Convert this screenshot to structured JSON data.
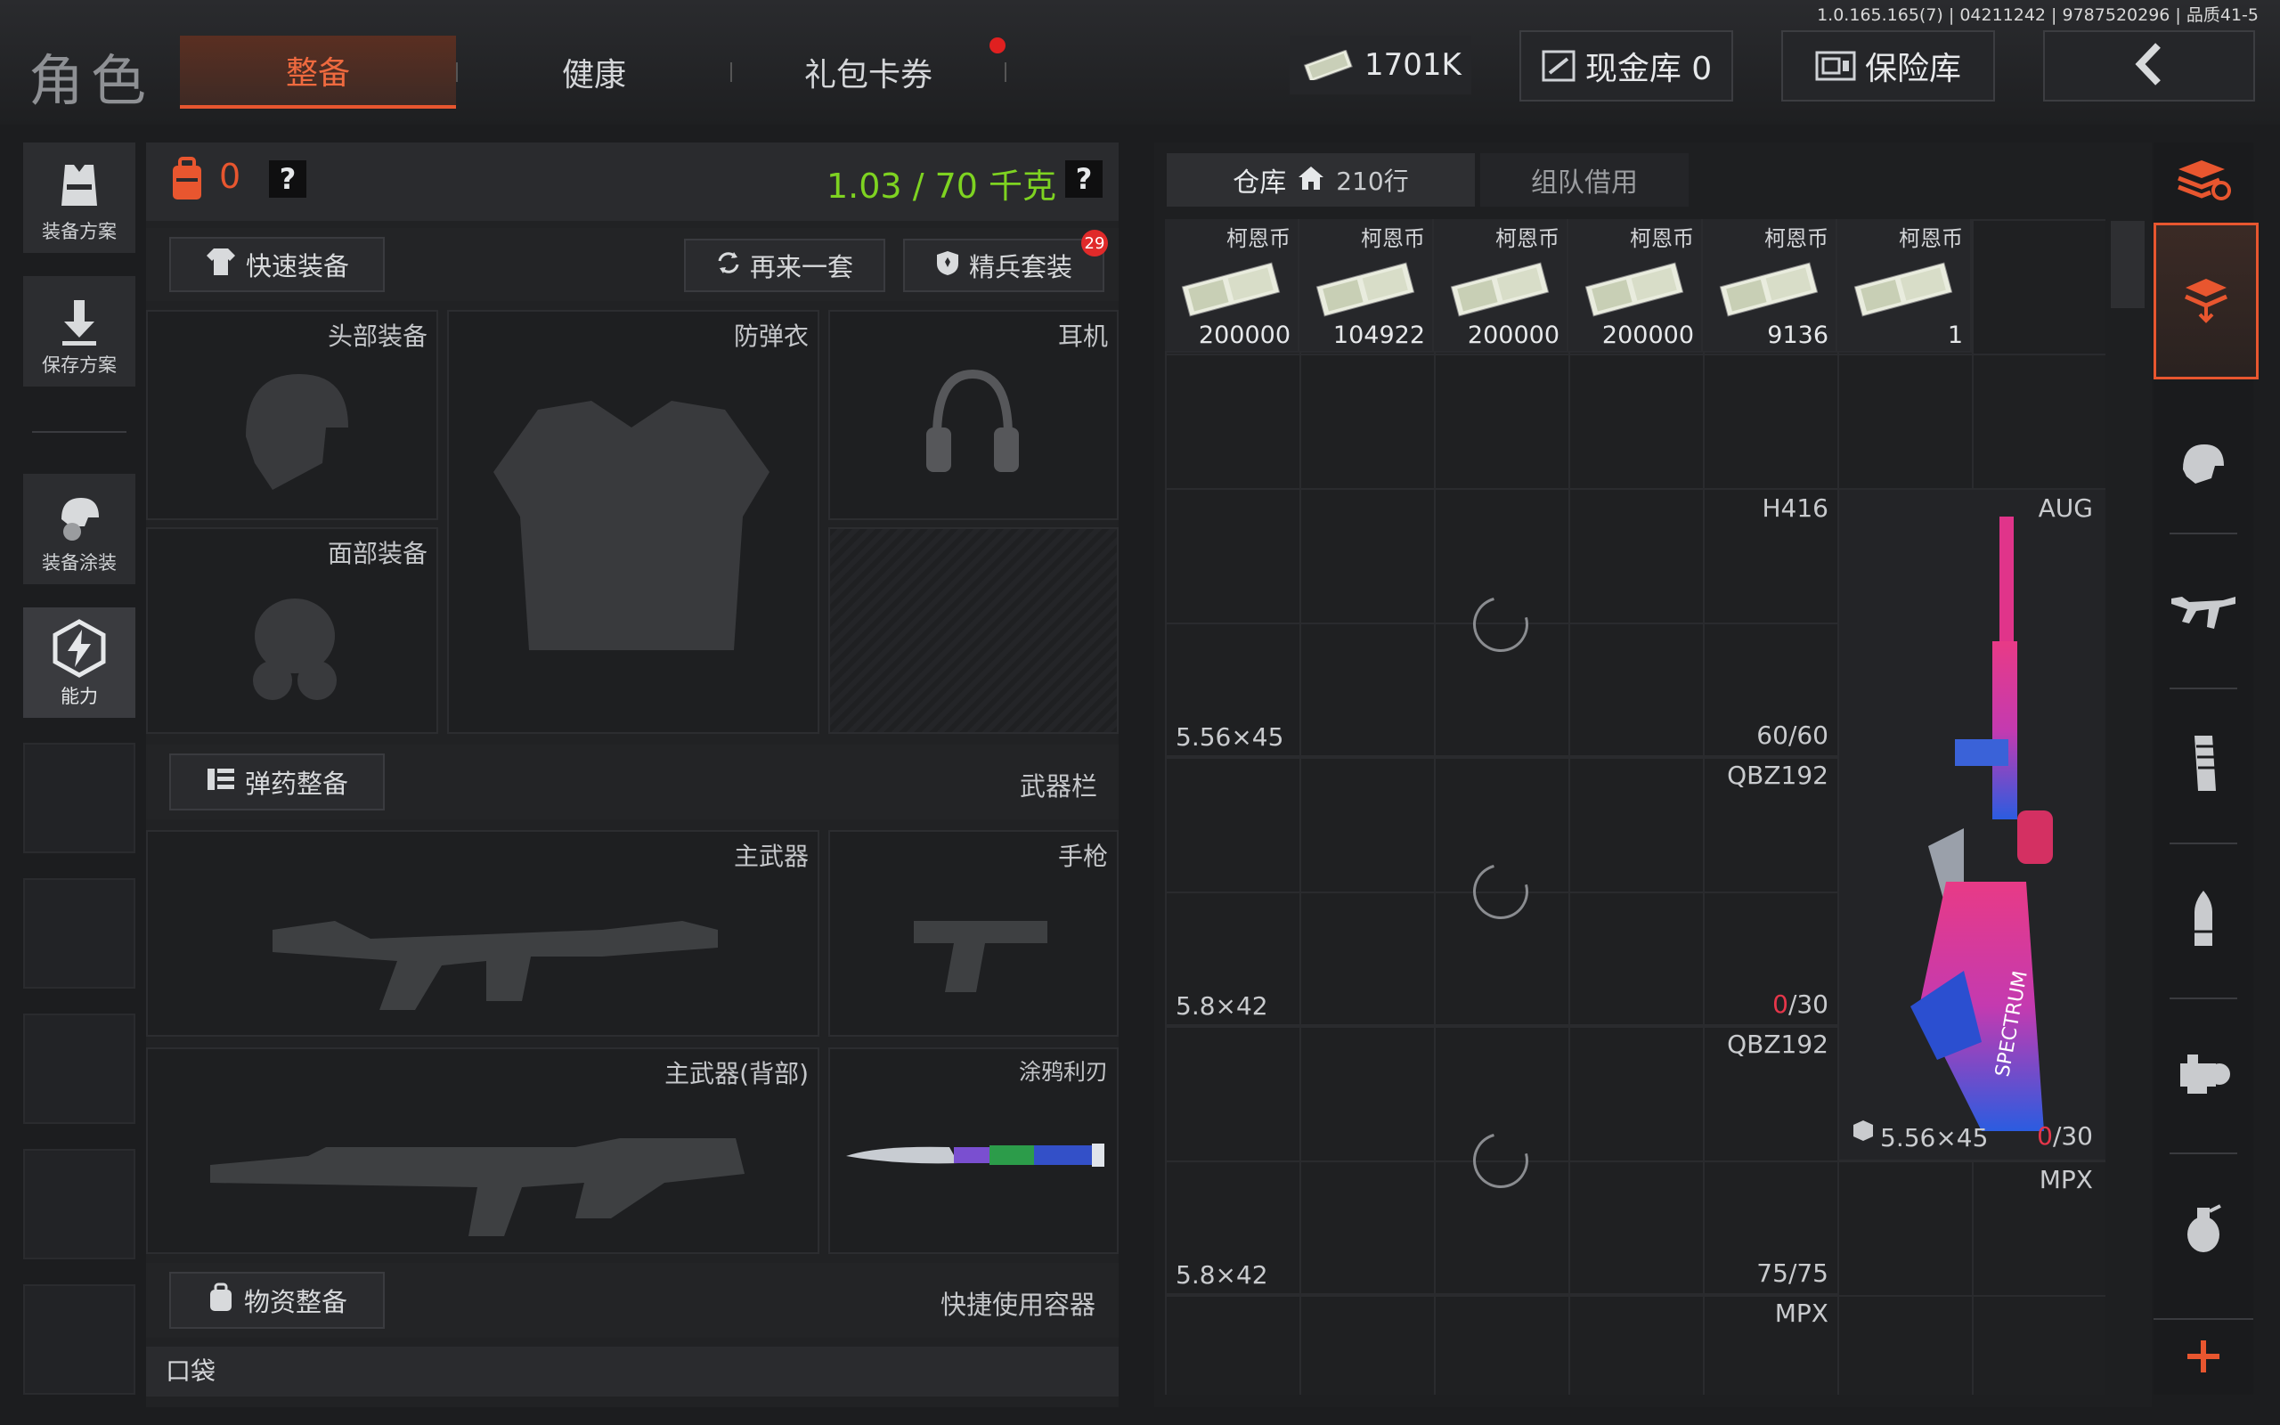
{
  "version_info": "1.0.165.165(7) | 04211242 | 9787520296 | 品质41-5",
  "header": {
    "title": "角色",
    "tabs": [
      {
        "label": "整备",
        "active": true
      },
      {
        "label": "健康",
        "active": false
      },
      {
        "label": "礼包卡券",
        "active": false
      }
    ],
    "currency": "1701K",
    "cash_vault": "现金库 0",
    "safe_box": "保险库"
  },
  "sidebar": [
    {
      "label": "装备方案",
      "icon": "vest-icon"
    },
    {
      "label": "保存方案",
      "icon": "download-icon"
    },
    {
      "label": "装备涂装",
      "icon": "helmet-paint-icon"
    },
    {
      "label": "能力",
      "icon": "lightning-icon"
    }
  ],
  "loadout": {
    "count": "0",
    "weight": "1.03 / 70 千克",
    "help": "?",
    "quick_equip": "快速装备",
    "again_set": "再来一套",
    "elite_set": "精兵套装",
    "elite_badge": "29",
    "slots": {
      "head": "头部装备",
      "armor": "防弹衣",
      "headset": "耳机",
      "face": "面部装备"
    },
    "ammo_section": "弹药整备",
    "weapon_bar": "武器栏",
    "primary": "主武器",
    "pistol": "手枪",
    "primary_back": "主武器(背部)",
    "melee": "涂鸦利刃",
    "supply_section": "物资整备",
    "quick_container": "快捷使用容器",
    "pocket": "口袋"
  },
  "warehouse": {
    "tab_label": "仓库",
    "rows": "210行",
    "team_tab": "组队借用",
    "money": [
      {
        "name": "柯恩币",
        "amount": "200000"
      },
      {
        "name": "柯恩币",
        "amount": "104922"
      },
      {
        "name": "柯恩币",
        "amount": "200000"
      },
      {
        "name": "柯恩币",
        "amount": "200000"
      },
      {
        "name": "柯恩币",
        "amount": "9136"
      },
      {
        "name": "柯恩币",
        "amount": "1"
      }
    ],
    "weapons": [
      {
        "name": "H416",
        "caliber": "5.56×45",
        "ammo_current": "60",
        "ammo_max": "/60"
      },
      {
        "name": "QBZ192",
        "caliber": "5.8×42",
        "ammo_current": "0",
        "ammo_max": "/30"
      },
      {
        "name": "QBZ192",
        "caliber": "5.8×42",
        "ammo_current": "75",
        "ammo_max": "/75"
      },
      {
        "name": "MPX",
        "caliber": "",
        "ammo_current": "",
        "ammo_max": ""
      }
    ],
    "aug": {
      "name": "AUG",
      "caliber": "5.56×45",
      "ammo_current": "0",
      "ammo_max": "/30"
    },
    "mpx_right": "MPX"
  },
  "colors": {
    "accent": "#e8562f",
    "weight_green": "#7ed321",
    "ammo_red": "#e5364a"
  }
}
